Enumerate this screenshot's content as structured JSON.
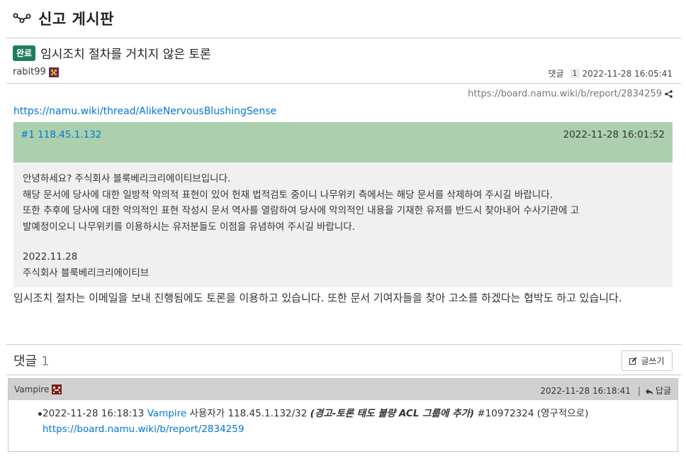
{
  "board": {
    "title": "신고 게시판",
    "icon": "routing-icon"
  },
  "post": {
    "status_badge": "완료",
    "title": "임시조치 절차를 거치지 않은 토론",
    "author": "rabit99",
    "comment_label": "댓글",
    "comment_count": "1",
    "date": "2022-11-28 16:05:41",
    "permalink": "https://board.namu.wiki/b/report/2834259",
    "thread_link": "https://namu.wiki/thread/AlikeNervousBlushingSense",
    "quoted_response": {
      "id": "#1 118.45.1.132",
      "date": "2022-11-28 16:01:52",
      "lines": [
        "안녕하세요? 주식회사 블룩베리크리에이티브입니다.",
        "해당 문서에 당사에 대한 일방적 악의적 표현이 있어 헌재 법적검토 중이니 나무위키 측에서는 해당 문서를 삭제하여 주시길 바랍니다.",
        "또한 추후에 당사에 대한 악의적인 표현 작성시 문서 역사를 열람하여 당사에 악의적인 내용을 기재한 유저를 반드시 찾아내어 수사기관에 고",
        "발예정이오니 나무위키를 이용하시는 유저분들도 이점을 유념하여 주시길 바랍니다."
      ],
      "sign_date": "2022.11.28",
      "sign_company": "주식회사 블룩베리크리에이티브"
    },
    "body": "임시조치 절차는 이메일을 보내 진행됨에도 토론을 이용하고 있습니다. 또한 문서 기여자들을 찾아 고소를 하겠다는 협박도 하고 있습니다."
  },
  "comments": {
    "label": "댓글",
    "count": "1",
    "write_label": "글쓰기",
    "items": [
      {
        "author": "Vampire",
        "date": "2022-11-28 16:18:41",
        "reply_label": "답글",
        "log": {
          "time": "2022-11-28 16:18:13",
          "user": "Vampire",
          "text_a": " 사용자가 118.45.1.132/32 ",
          "action": "(경고-토론 태도 불량 ACL 그룹에 추가)",
          "text_b": " #10972324 (영구적으로) ",
          "link": "https://board.namu.wiki/b/report/2834259"
        }
      }
    ]
  },
  "colors": {
    "badge": "#1e7e5b",
    "response_header": "#acd0ad",
    "response_body": "#f0f0f0",
    "link": "#0275d8",
    "comment_header": "#d0d0d0"
  }
}
